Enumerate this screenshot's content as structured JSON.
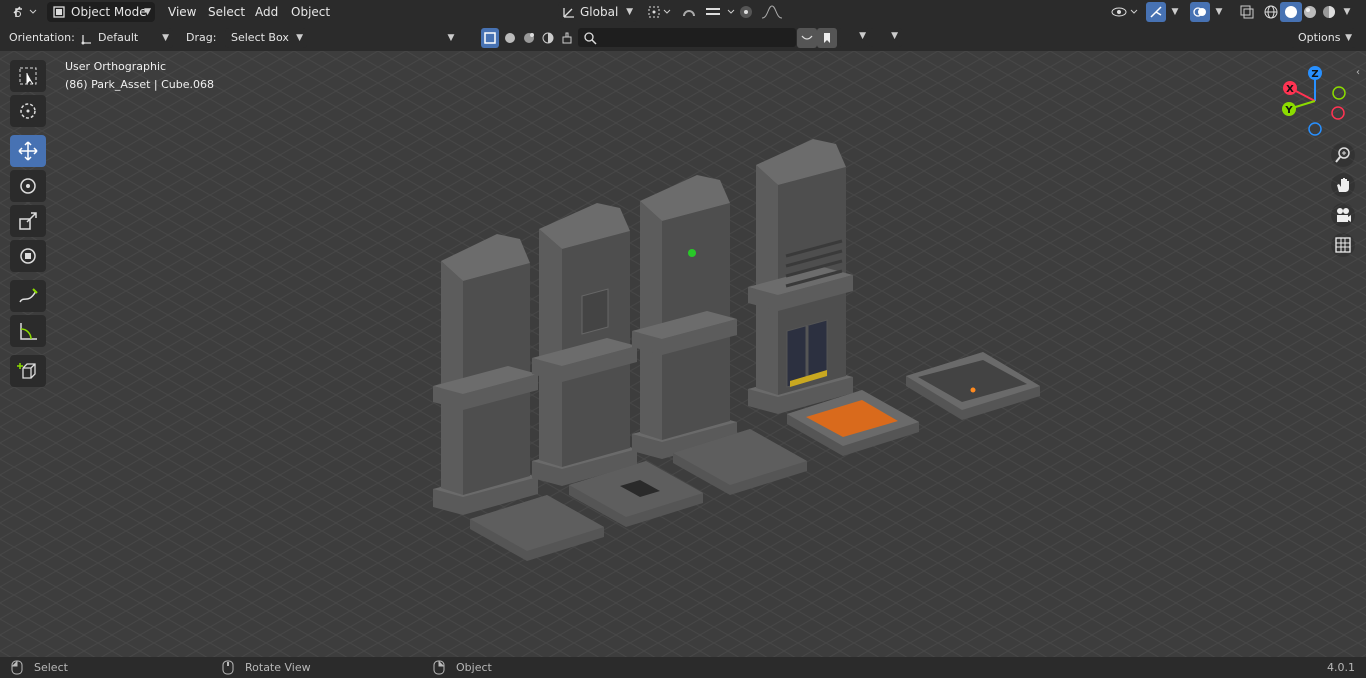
{
  "header": {
    "mode": "Object Mode",
    "menus": [
      "View",
      "Select",
      "Add",
      "Object"
    ],
    "transform_orientation": "Global"
  },
  "tool_settings": {
    "orientation_label": "Orientation:",
    "orientation_value": "Default",
    "drag_label": "Drag:",
    "drag_value": "Select Box",
    "options_label": "Options"
  },
  "viewport": {
    "view_name": "User Orthographic",
    "object_info": "(86) Park_Asset | Cube.068"
  },
  "gizmo": {
    "z": "Z",
    "x": "X",
    "y": "Y"
  },
  "status": {
    "select": "Select",
    "rotate_view": "Rotate View",
    "object": "Object",
    "version": "4.0.1"
  },
  "colors": {
    "accent": "#4772b3",
    "header_bg": "#2b2b2b",
    "viewport_bg": "#3d3d3d",
    "axis_x": "#ff3352",
    "axis_y": "#8bdc00",
    "axis_z": "#2890ff",
    "hatch": "#d96a1c"
  },
  "icons": [
    "editor-type-icon",
    "mode-icon",
    "orientation-icon",
    "pivot-icon",
    "snap-icon",
    "proportional-icon",
    "overlay-icon",
    "xray-icon",
    "shading-wireframe-icon",
    "shading-solid-icon",
    "shading-material-icon",
    "shading-rendered-icon",
    "select-box-icon",
    "cursor-icon",
    "move-icon",
    "rotate-icon",
    "scale-icon",
    "transform-icon",
    "annotate-icon",
    "measure-icon",
    "add-cube-icon",
    "zoom-icon",
    "hand-icon",
    "camera-icon",
    "grid-icon",
    "mouse-left-icon",
    "mouse-middle-icon",
    "mouse-right-icon"
  ]
}
